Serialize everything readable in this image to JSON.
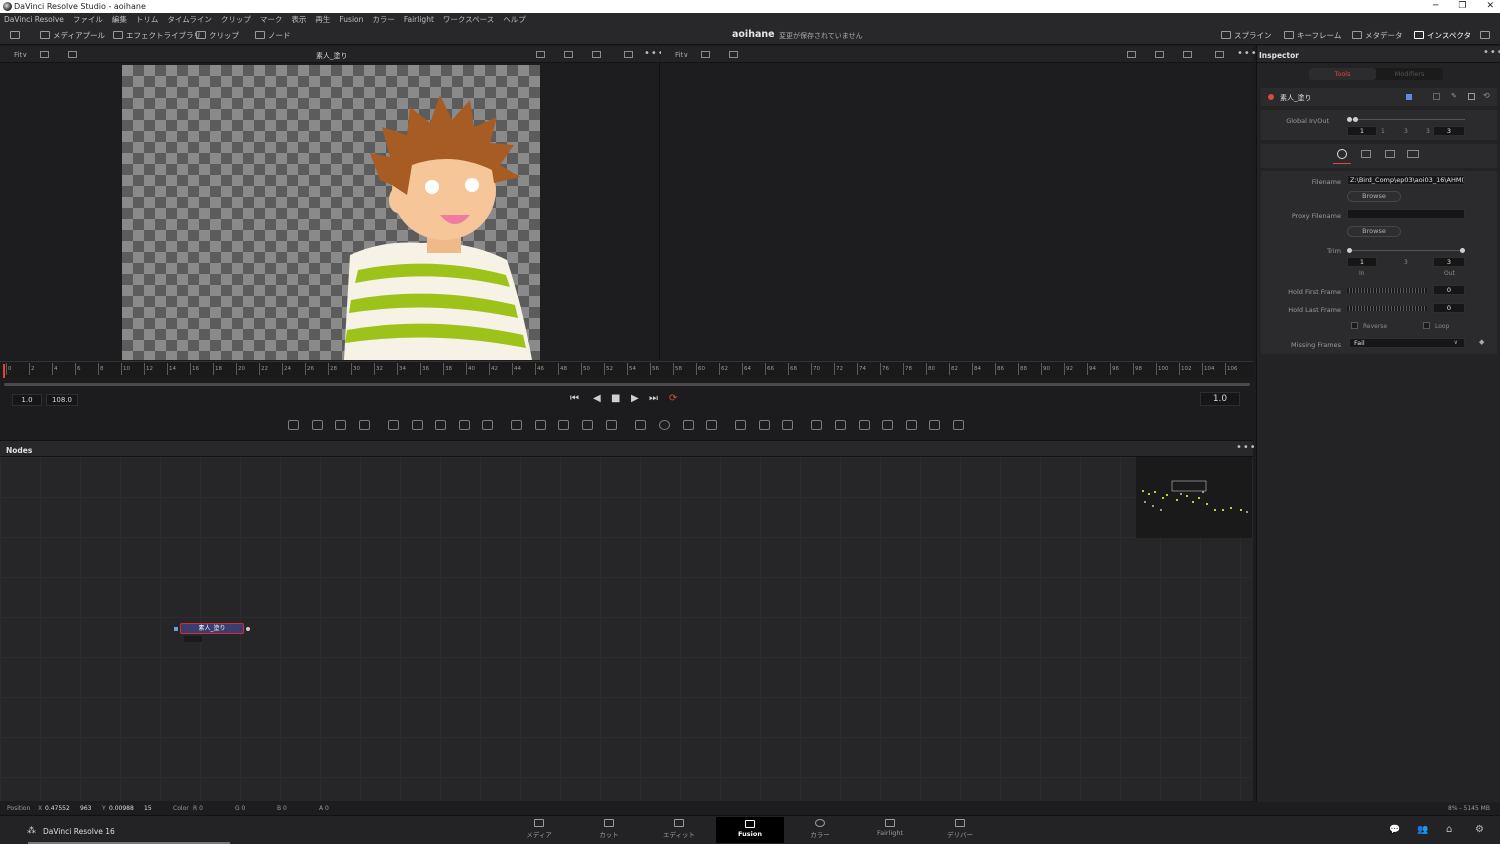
{
  "window": {
    "title": "DaVinci Resolve Studio - aoihane",
    "controls": [
      "─",
      "❐",
      "✕"
    ]
  },
  "menu": [
    "DaVinci Resolve",
    "ファイル",
    "編集",
    "トリム",
    "タイムライン",
    "クリップ",
    "マーク",
    "表示",
    "再生",
    "Fusion",
    "カラー",
    "Fairlight",
    "ワークスペース",
    "ヘルプ"
  ],
  "toolbar": {
    "media_pool": "メディアプール",
    "effects_library": "エフェクトライブラリ",
    "clips": "クリップ",
    "nodes": "ノード",
    "project_name": "aoihane",
    "project_status": "変更が保存されていません",
    "spline": "スプライン",
    "keyframes": "キーフレーム",
    "metadata": "メタデータ",
    "inspector": "インスペクタ"
  },
  "viewer": {
    "left_fit": "Fit∨",
    "left_title": "素人_塗り",
    "right_fit": "Fit∨"
  },
  "timeline": {
    "ticks": [
      "0",
      "2",
      "4",
      "6",
      "8",
      "10",
      "12",
      "14",
      "16",
      "18",
      "20",
      "22",
      "24",
      "26",
      "28",
      "30",
      "32",
      "34",
      "36",
      "38",
      "40",
      "42",
      "44",
      "46",
      "48",
      "50",
      "52",
      "54",
      "56",
      "58",
      "60",
      "62",
      "64",
      "66",
      "68",
      "70",
      "72",
      "74",
      "76",
      "78",
      "80",
      "82",
      "84",
      "86",
      "88",
      "90",
      "92",
      "94",
      "96",
      "98",
      "100",
      "102",
      "104",
      "106"
    ],
    "render_start": "1.0",
    "render_end": "108.0",
    "current_time": "1.0"
  },
  "nodes_panel": {
    "title": "Nodes",
    "node_label": "素人_塗り"
  },
  "status": {
    "position_label": "Position",
    "x_label": "X",
    "x_value": "0.47552",
    "x_pixel": "963",
    "y_label": "Y",
    "y_value": "0.00988",
    "y_pixel": "15",
    "color_label": "Color",
    "r": "R 0",
    "g": "G 0",
    "b": "B 0",
    "a": "A 0",
    "memory": "8% - 5145 MB"
  },
  "pages": {
    "app_name": "DaVinci Resolve 16",
    "items": [
      "メディア",
      "カット",
      "エディット",
      "Fusion",
      "カラー",
      "Fairlight",
      "デリバー"
    ],
    "active": "Fusion"
  },
  "inspector": {
    "title": "Inspector",
    "tabs": [
      "Tools",
      "Modifiers"
    ],
    "tool_name": "素人_塗り",
    "global_label": "Global In/Out",
    "global_in": "1",
    "global_mid1": "1",
    "global_mid2": "3",
    "global_mid3": "3",
    "global_out": "3",
    "filename_label": "Filename",
    "filename_value": "Z:\\Bird_Comp\\ep03\\aoi03_16\\AHM(",
    "browse": "Browse",
    "proxy_label": "Proxy Filename",
    "proxy_value": "",
    "trim_label": "Trim",
    "trim_in": "1",
    "trim_mid": "3",
    "trim_out": "3",
    "in_label": "In",
    "out_label": "Out",
    "hold_first_label": "Hold First Frame",
    "hold_first_value": "0",
    "hold_last_label": "Hold Last Frame",
    "hold_last_value": "0",
    "reverse_label": "Reverse",
    "loop_label": "Loop",
    "missing_label": "Missing Frames",
    "missing_value": "Fail"
  },
  "colors": {
    "accent_red": "#d84a3a",
    "shirt_green": "#9dc21a",
    "hair_brown": "#a65c22"
  }
}
